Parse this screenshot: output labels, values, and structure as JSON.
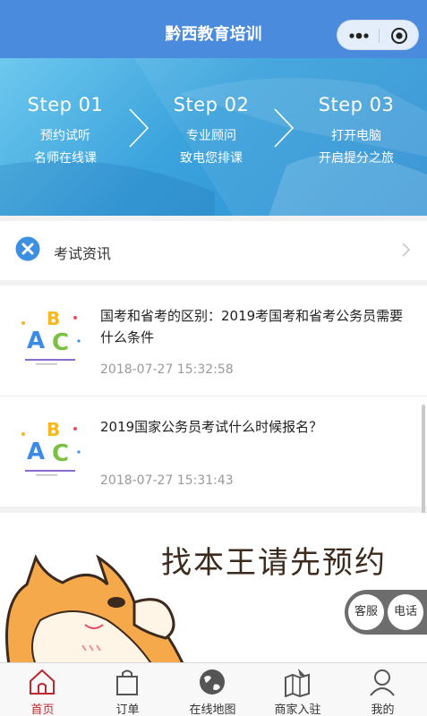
{
  "header": {
    "title": "黔西教育培训",
    "more_icon": "more-dots-icon",
    "close_icon": "target-circle-icon"
  },
  "banner": {
    "steps": [
      {
        "num": "Step  01",
        "line1": "预约试听",
        "line2": "名师在线课"
      },
      {
        "num": "Step  02",
        "line1": "专业顾问",
        "line2": "致电您排课"
      },
      {
        "num": "Step  03",
        "line1": "打开电脑",
        "line2": "开启提分之旅"
      }
    ],
    "arrow_icon": "chevron-right-icon"
  },
  "news_section": {
    "icon": "x-circle-icon",
    "label": "考试资讯"
  },
  "news": [
    {
      "title": "国考和省考的区别：2019考国考和省考公务员需要什么条件",
      "date": "2018-07-27 15:32:58",
      "thumb": "abc-blocks-image"
    },
    {
      "title": "2019国家公务员考试什么时候报名？",
      "date": "2018-07-27 15:31:43",
      "thumb": "abc-blocks-image"
    }
  ],
  "promo": {
    "slogan": "找本王请先预约"
  },
  "float": {
    "service": "客服",
    "phone": "电话"
  },
  "tabbar": {
    "items": [
      {
        "label": "首页",
        "icon": "home-icon",
        "active": true
      },
      {
        "label": "订单",
        "icon": "shopping-bag-icon",
        "active": false
      },
      {
        "label": "在线地图",
        "icon": "map-globe-icon",
        "active": false
      },
      {
        "label": "商家入驻",
        "icon": "store-map-icon",
        "active": false
      },
      {
        "label": "我的",
        "icon": "user-icon",
        "active": false
      }
    ]
  },
  "colors": {
    "header": "#4a8bde",
    "active_tab": "#c0262d",
    "banner": "#3aa2dc"
  }
}
